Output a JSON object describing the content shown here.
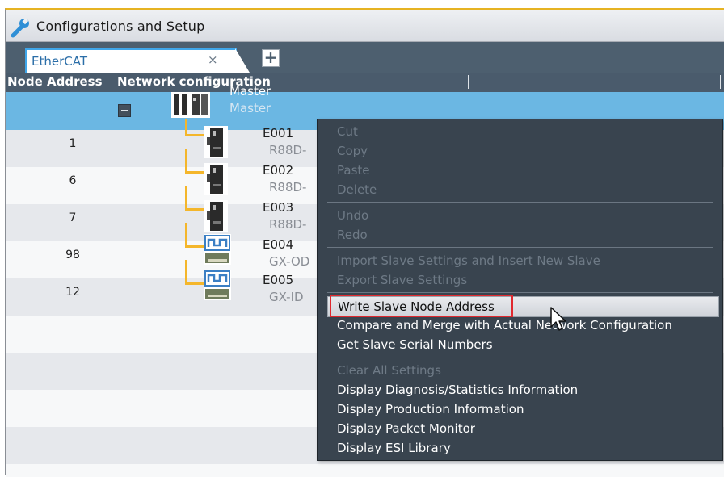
{
  "window": {
    "title": "Configurations and Setup",
    "icon": "wrench-icon"
  },
  "tabs": {
    "active_label": "EtherCAT",
    "close_glyph": "×",
    "add_glyph": "+"
  },
  "columns": {
    "node_address": "Node Address",
    "network_configuration": "Network configuration"
  },
  "master": {
    "name": "Master",
    "model": "Master"
  },
  "devices": [
    {
      "address": "1",
      "name": "E001",
      "model": "R88D-"
    },
    {
      "address": "6",
      "name": "E002",
      "model": "R88D-"
    },
    {
      "address": "7",
      "name": "E003",
      "model": "R88D-"
    },
    {
      "address": "98",
      "name": "E004",
      "model": "GX-OD"
    },
    {
      "address": "12",
      "name": "E005",
      "model": "GX-ID"
    }
  ],
  "context_menu": {
    "items": [
      {
        "label": "Cut",
        "enabled": false
      },
      {
        "label": "Copy",
        "enabled": false
      },
      {
        "label": "Paste",
        "enabled": false
      },
      {
        "label": "Delete",
        "enabled": false
      },
      {
        "label": "Undo",
        "enabled": false
      },
      {
        "label": "Redo",
        "enabled": false
      },
      {
        "label": "Import Slave Settings and Insert New Slave",
        "enabled": false
      },
      {
        "label": "Export Slave Settings",
        "enabled": false
      },
      {
        "label": "Write Slave Node Address",
        "enabled": true,
        "highlighted": true
      },
      {
        "label": "Compare and Merge with Actual Network Configuration",
        "enabled": true
      },
      {
        "label": "Get Slave Serial Numbers",
        "enabled": true
      },
      {
        "label": "Clear All Settings",
        "enabled": false
      },
      {
        "label": "Display Diagnosis/Statistics Information",
        "enabled": true
      },
      {
        "label": "Display Production Information",
        "enabled": true
      },
      {
        "label": "Display Packet Monitor",
        "enabled": true
      },
      {
        "label": "Display ESI Library",
        "enabled": true
      }
    ]
  },
  "colors": {
    "accent_gold": "#e6b323",
    "selection_blue": "#6bb7e3",
    "header_slate": "#4a5b6c",
    "connector_orange": "#f4b62b",
    "menu_bg": "#39444f",
    "highlight_red": "#e0282e"
  }
}
